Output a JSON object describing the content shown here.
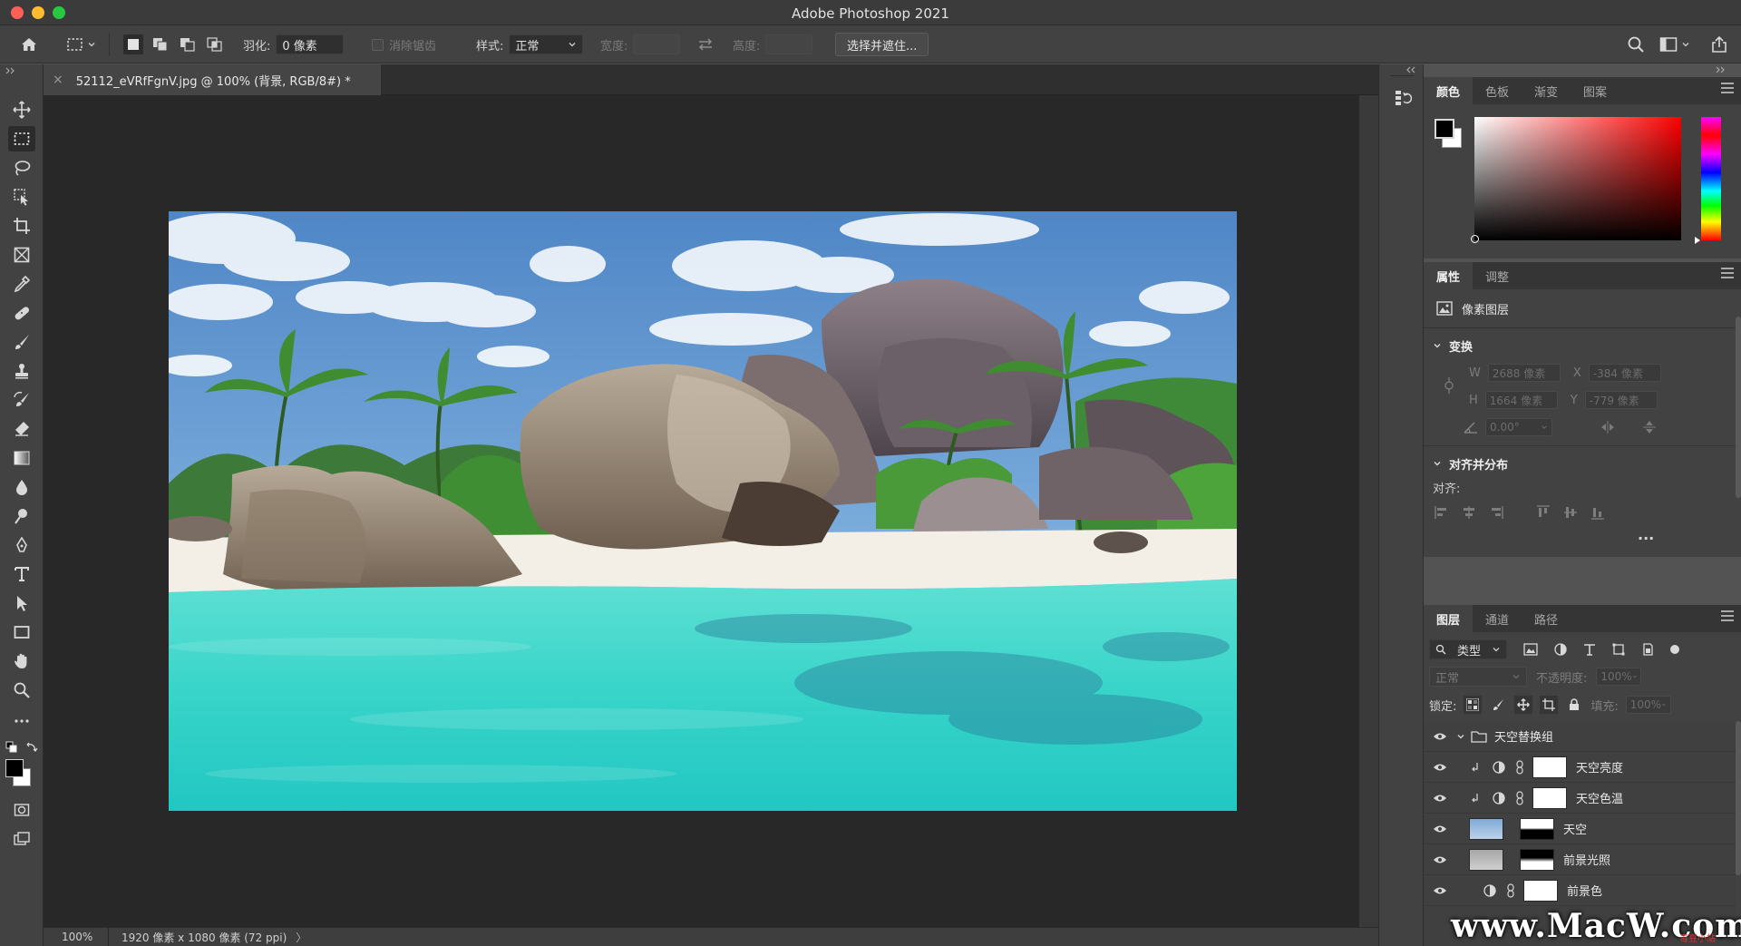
{
  "window": {
    "title": "Adobe Photoshop 2021"
  },
  "options_bar": {
    "feather_label": "羽化:",
    "feather_value": "0 像素",
    "antialias_label": "消除锯齿",
    "style_label": "样式:",
    "style_value": "正常",
    "width_label": "宽度:",
    "height_label": "高度:",
    "select_mask_button": "选择并遮住..."
  },
  "document": {
    "tab_title": "52112_eVRfFgnV.jpg @ 100% (背景, RGB/8#) *",
    "tab_close": "×"
  },
  "status_bar": {
    "zoom": "100%",
    "doc_info": "1920 像素 x 1080 像素 (72 ppi)",
    "arrow": "〉"
  },
  "color_panel": {
    "tabs": [
      "颜色",
      "色板",
      "渐变",
      "图案"
    ],
    "active_tab": 0,
    "foreground": "#000000",
    "background": "#ffffff",
    "hue_color": "#ff0000"
  },
  "properties_panel": {
    "tabs": [
      "属性",
      "调整"
    ],
    "active_tab": 0,
    "layer_type": "像素图层",
    "transform_section": "变换",
    "w_label": "W",
    "w_value": "2688 像素",
    "x_label": "X",
    "x_value": "-384 像素",
    "h_label": "H",
    "h_value": "1664 像素",
    "y_label": "Y",
    "y_value": "-779 像素",
    "angle_value": "0.00°",
    "align_section": "对齐并分布",
    "align_label": "对齐:",
    "more": "···"
  },
  "layers_panel": {
    "tabs": [
      "图层",
      "通道",
      "路径"
    ],
    "active_tab": 0,
    "filter_kind": "类型",
    "blend_mode": "正常",
    "opacity_label": "不透明度:",
    "opacity_value": "100%",
    "lock_label": "锁定:",
    "fill_label": "填充:",
    "fill_value": "100%",
    "layers": [
      {
        "name": "天空替换组",
        "kind": "group"
      },
      {
        "name": "天空亮度",
        "kind": "adjustment"
      },
      {
        "name": "天空色温",
        "kind": "adjustment"
      },
      {
        "name": "天空",
        "kind": "masked-image"
      },
      {
        "name": "前景光照",
        "kind": "masked-image"
      },
      {
        "name": "前景色",
        "kind": "adjustment"
      }
    ]
  },
  "watermark": {
    "text": "www.MacW.com",
    "sub": "毒豆小站"
  }
}
